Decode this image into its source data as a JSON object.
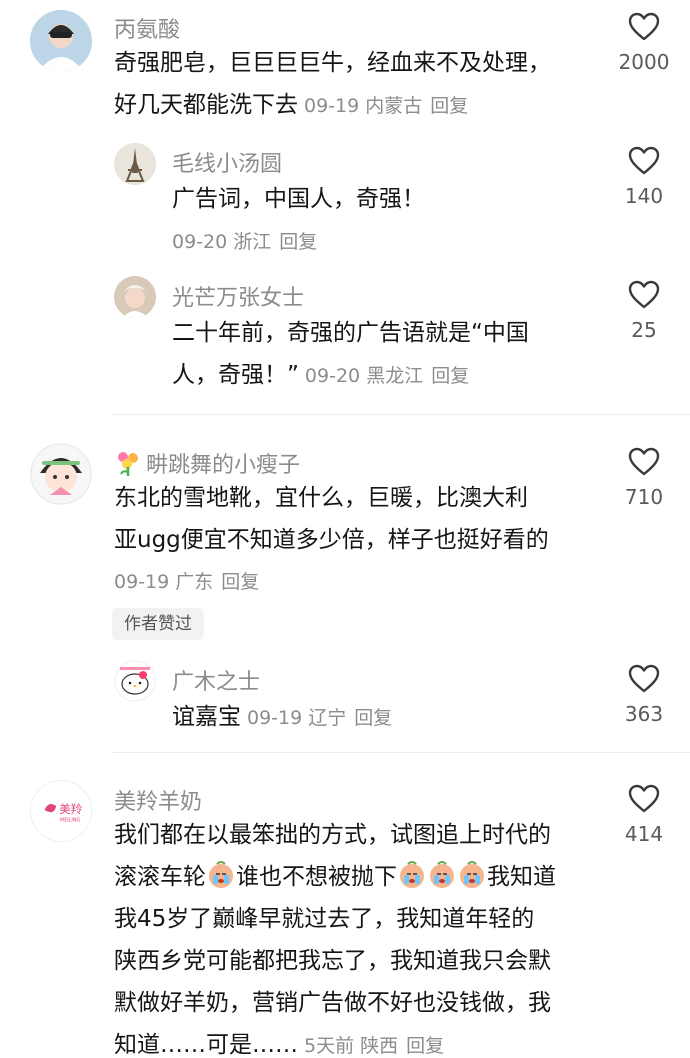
{
  "comments": [
    {
      "name": "丙氨酸",
      "text": "奇强肥皂，巨巨巨巨牛，经血来不及处理，好几天都能洗下去",
      "line1": "奇强肥皂，巨巨巨巨牛，经血来不及处理，",
      "line2": "好几天都能洗下去",
      "date": "09-19",
      "location": "内蒙古",
      "reply": "回复",
      "likes": "2000"
    },
    {
      "name": "毛线小汤圆",
      "text": "广告词，中国人，奇强！",
      "date": "09-20",
      "location": "浙江",
      "reply": "回复",
      "likes": "140"
    },
    {
      "name": "光芒万张女士",
      "line1": "二十年前，奇强的广告语就是“中国",
      "line2": "人，奇强！”",
      "date": "09-20",
      "location": "黑龙江",
      "reply": "回复",
      "likes": "25"
    },
    {
      "name": "畊跳舞的小瘦子",
      "line1": "东北的雪地靴，宜什么，巨暖，比澳大利",
      "line2": "亚ugg便宜不知道多少倍，样子也挺好看的",
      "date": "09-19",
      "location": "广东",
      "reply": "回复",
      "likes": "710",
      "badge": "作者赞过"
    },
    {
      "name": "广木之士",
      "text": "谊嘉宝",
      "date": "09-19",
      "location": "辽宁",
      "reply": "回复",
      "likes": "363"
    },
    {
      "name": "美羚羊奶",
      "line1": "我们都在以最笨拙的方式，试图追上时代的",
      "line2a": "滚滚车轮",
      "line2b": "谁也不想被抛下",
      "line2c": "我知道",
      "line3": "我45岁了巅峰早就过去了，我知道年轻的",
      "line4": "陕西乡党可能都把我忘了，我知道我只会默",
      "line5": "默做好羊奶，营销广告做不好也没钱做，我",
      "line6": "知道……可是……",
      "date": "5天前",
      "location": "陕西",
      "reply": "回复",
      "likes": "414",
      "avatar_text": "美羚",
      "avatar_sub": "MEILING"
    }
  ],
  "colors": {
    "meta": "#8c8c8c",
    "text": "#161616",
    "brand_pink": "#e0457b"
  }
}
